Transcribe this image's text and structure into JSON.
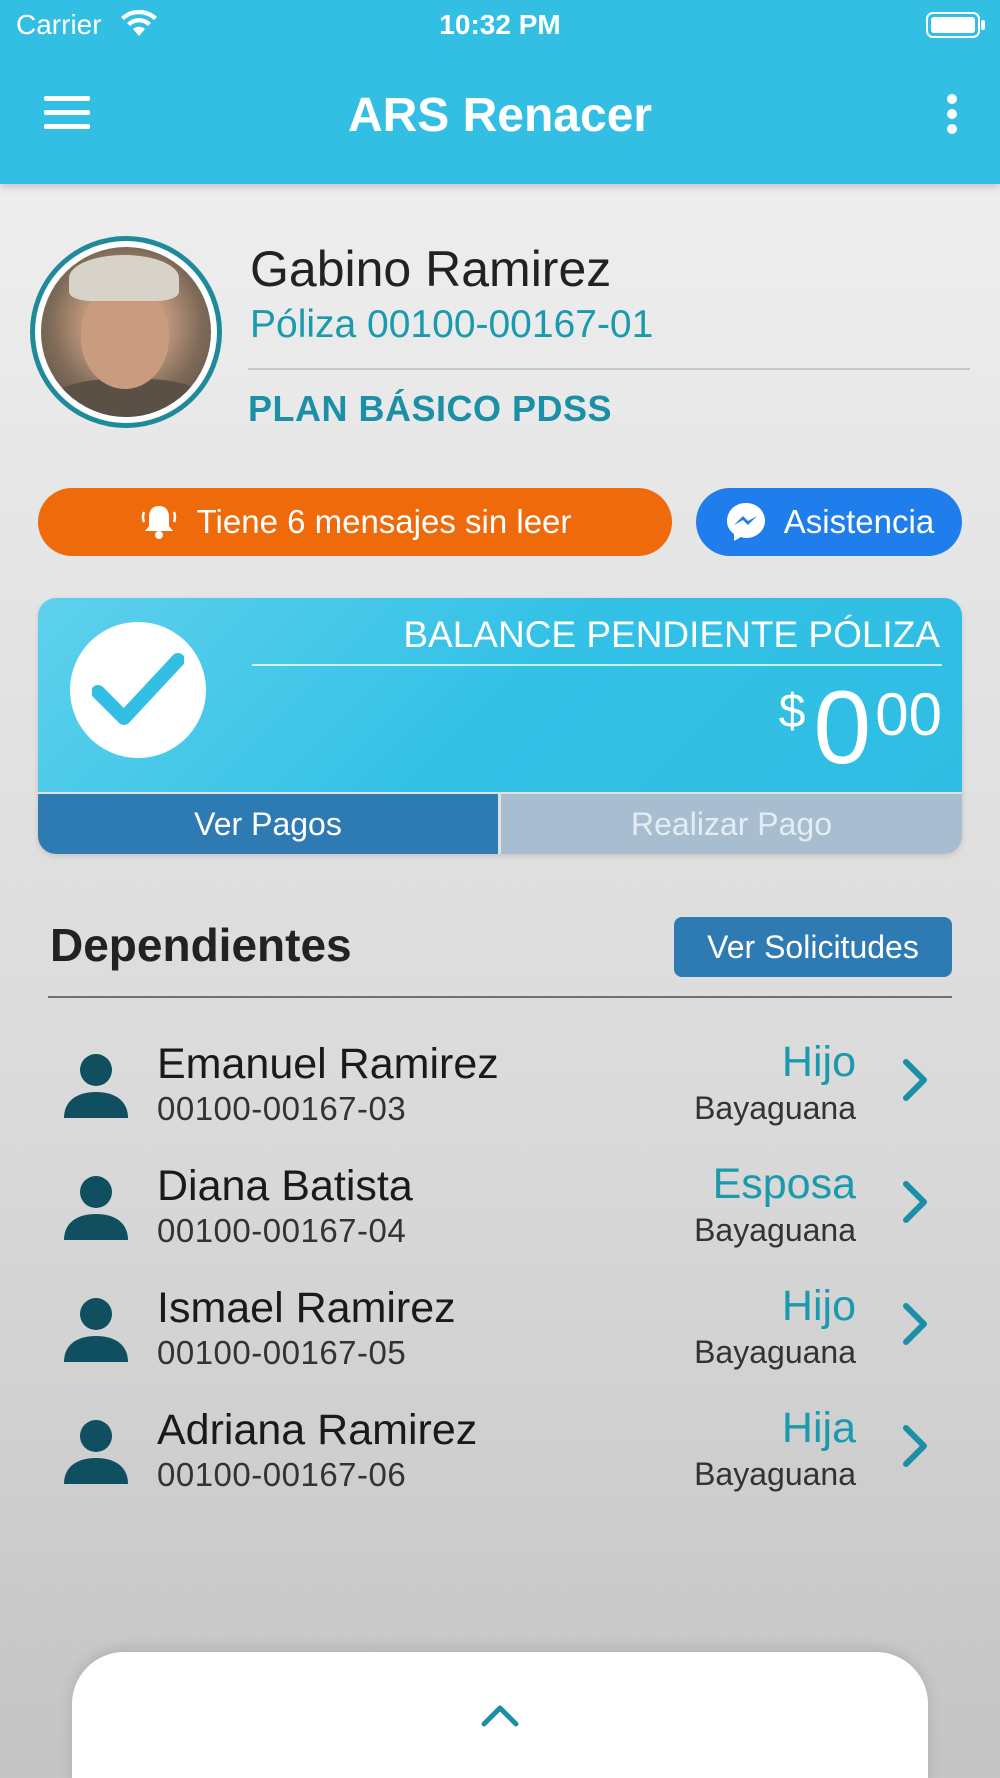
{
  "status_bar": {
    "carrier": "Carrier",
    "time": "10:32 PM"
  },
  "header": {
    "title": "ARS Renacer"
  },
  "profile": {
    "name": "Gabino Ramirez",
    "policy": "Póliza 00100-00167-01",
    "plan": "PLAN BÁSICO PDSS"
  },
  "notifications": {
    "messages_label": "Tiene 6 mensajes sin leer",
    "assist_label": "Asistencia"
  },
  "balance": {
    "label": "BALANCE PENDIENTE PÓLIZA",
    "currency": "$",
    "whole": "0",
    "cents": "00",
    "view_payments": "Ver Pagos",
    "make_payment": "Realizar Pago"
  },
  "dependents": {
    "heading": "Dependientes",
    "requests_button": "Ver Solicitudes",
    "items": [
      {
        "name": "Emanuel Ramirez",
        "policy": "00100-00167-03",
        "relation": "Hijo",
        "city": "Bayaguana"
      },
      {
        "name": "Diana Batista",
        "policy": "00100-00167-04",
        "relation": "Esposa",
        "city": "Bayaguana"
      },
      {
        "name": "Ismael Ramirez",
        "policy": "00100-00167-05",
        "relation": "Hijo",
        "city": "Bayaguana"
      },
      {
        "name": "Adriana Ramirez",
        "policy": "00100-00167-06",
        "relation": "Hija",
        "city": "Bayaguana"
      }
    ]
  },
  "colors": {
    "header": "#33bfe4",
    "accent_teal": "#1a9aac",
    "orange": "#ee6a0b",
    "messenger_blue": "#1f7dec",
    "button_blue": "#2e7bb4",
    "dependent_icon": "#0f4f5f"
  },
  "icons": {
    "menu": "hamburger-icon",
    "more": "kebab-icon",
    "messages": "bell-icon",
    "assist": "messenger-icon",
    "balance_status": "check-icon",
    "dependent": "person-icon",
    "row_action": "chevron-right-icon",
    "sheet_toggle": "chevron-up-icon"
  }
}
